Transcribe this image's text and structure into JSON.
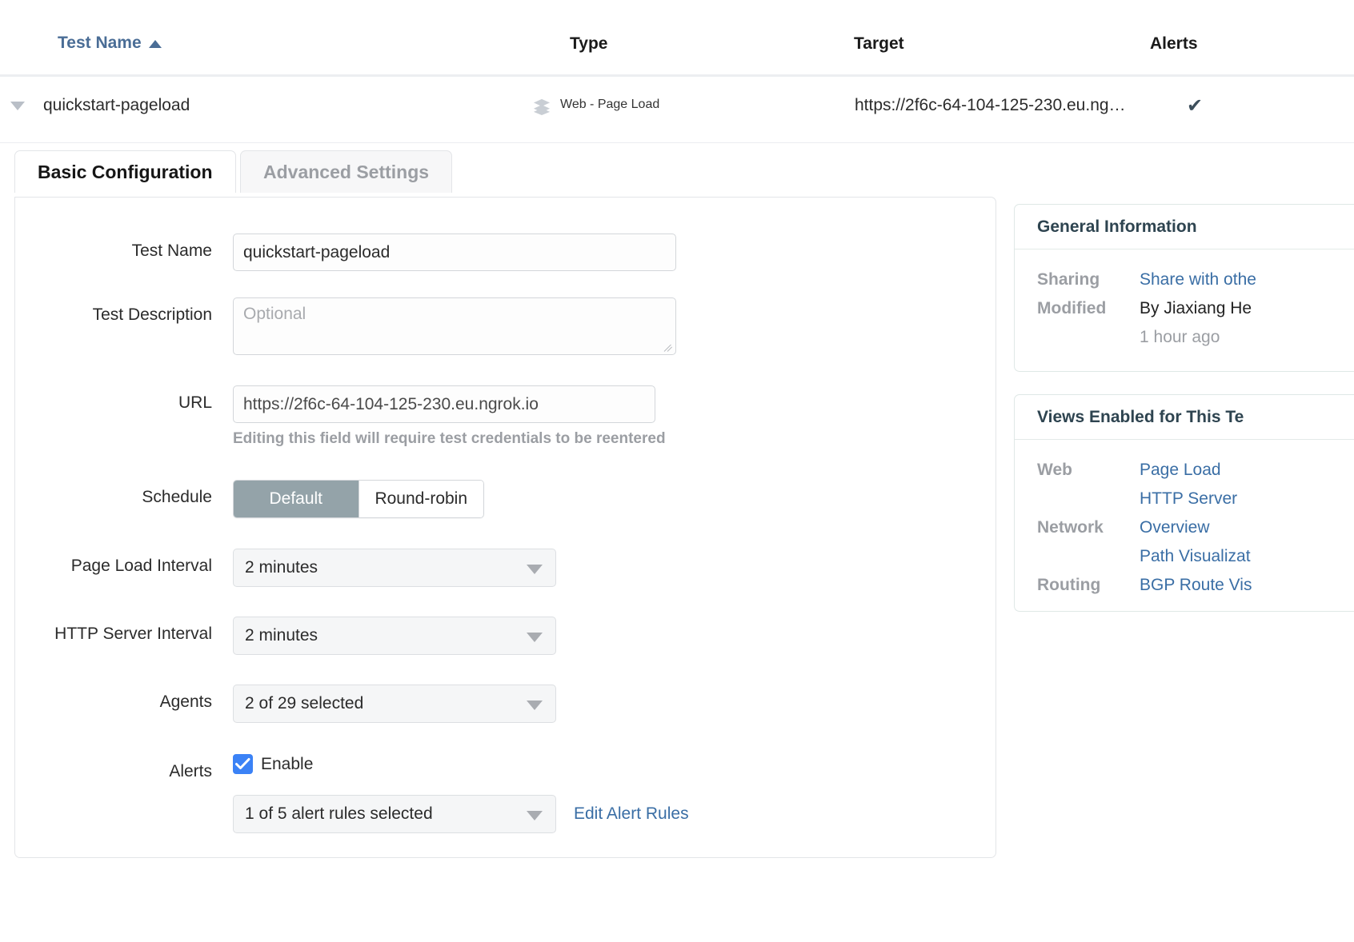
{
  "table": {
    "columns": {
      "test_name": "Test Name",
      "type": "Type",
      "target": "Target",
      "alerts": "Alerts"
    },
    "sort_icon": "sort-ascending-icon",
    "row": {
      "expand_icon": "caret-down-icon",
      "name": "quickstart-pageload",
      "type_icon": "layers-icon",
      "type": "Web - Page Load",
      "target": "https://2f6c-64-104-125-230.eu.ng…",
      "alert_icon": "checkmark-icon"
    }
  },
  "tabs": [
    {
      "label": "Basic Configuration",
      "active": true
    },
    {
      "label": "Advanced Settings",
      "active": false
    }
  ],
  "form": {
    "test_name": {
      "label": "Test Name",
      "value": "quickstart-pageload"
    },
    "test_description": {
      "label": "Test Description",
      "value": "",
      "placeholder": "Optional"
    },
    "url": {
      "label": "URL",
      "value": "https://2f6c-64-104-125-230.eu.ngrok.io",
      "helper": "Editing this field will require test credentials to be reentered"
    },
    "schedule": {
      "label": "Schedule",
      "options": [
        "Default",
        "Round-robin"
      ],
      "selected": "Default"
    },
    "page_load_interval": {
      "label": "Page Load Interval",
      "value": "2 minutes"
    },
    "http_server_interval": {
      "label": "HTTP Server Interval",
      "value": "2 minutes"
    },
    "agents": {
      "label": "Agents",
      "value": "2 of 29 selected"
    },
    "alerts": {
      "label": "Alerts",
      "enable_label": "Enable",
      "enabled": true,
      "rules_value": "1 of 5 alert rules selected",
      "edit_link": "Edit Alert Rules"
    }
  },
  "sidebar": {
    "general_information": {
      "title": "General Information",
      "sharing_key": "Sharing",
      "sharing_link": "Share with othe",
      "modified_key": "Modified",
      "modified_value": "By Jiaxiang He",
      "modified_time": "1 hour ago"
    },
    "views_enabled": {
      "title": "Views Enabled for This Te",
      "groups": [
        {
          "key": "Web",
          "items": [
            "Page Load",
            "HTTP Server"
          ]
        },
        {
          "key": "Network",
          "items": [
            "Overview",
            "Path Visualizat"
          ]
        },
        {
          "key": "Routing",
          "items": [
            "BGP Route Vis"
          ]
        }
      ]
    }
  },
  "colors": {
    "link": "#3a6ea5",
    "header_link": "#4a6d96",
    "checkbox": "#3b82f6",
    "segment_selected": "#94a3a9"
  }
}
